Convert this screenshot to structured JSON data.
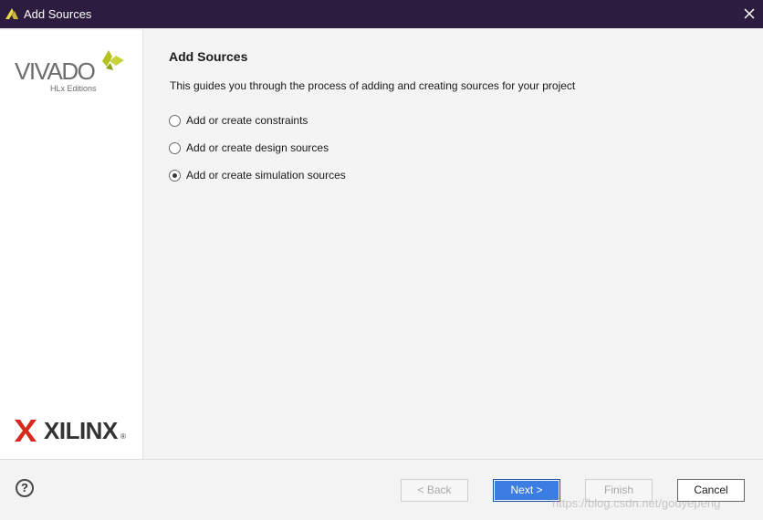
{
  "window": {
    "title": "Add Sources",
    "icon": "vivado-icon",
    "close_icon": "close-icon"
  },
  "sidebar": {
    "vivado_logo_text": "VIVADO",
    "vivado_edition_text": "HLx Editions",
    "xilinx_logo_text": "XILINX",
    "xilinx_reg_mark": "®"
  },
  "main": {
    "heading": "Add Sources",
    "description": "This guides you through the process of adding and creating sources for your project",
    "options": [
      {
        "label": "Add or create constraints",
        "checked": false
      },
      {
        "label": "Add or create design sources",
        "checked": false
      },
      {
        "label": "Add or create simulation sources",
        "checked": true
      }
    ]
  },
  "footer": {
    "help_label": "?",
    "back_label": "< Back",
    "next_label": "Next >",
    "finish_label": "Finish",
    "cancel_label": "Cancel"
  },
  "watermark": "https://blog.csdn.net/gouyepeng",
  "colors": {
    "titlebar": "#2b1c40",
    "primary_button": "#3b7de2",
    "vivado_leaf": "#b5c21e"
  }
}
